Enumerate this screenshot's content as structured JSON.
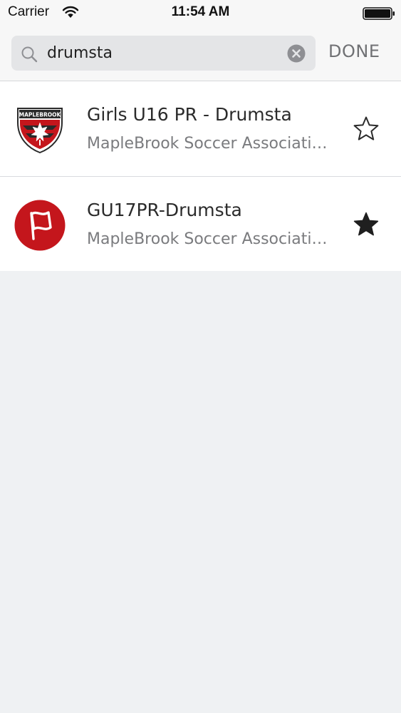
{
  "status_bar": {
    "carrier": "Carrier",
    "time": "11:54 AM"
  },
  "search": {
    "value": "drumsta",
    "done_label": "DONE"
  },
  "results": [
    {
      "title": "Girls U16 PR - Drumsta",
      "subtitle": "MapleBrook Soccer Association",
      "logo": "maplebrook-crest",
      "logo_text": "MAPLEBROOK",
      "favorite": false
    },
    {
      "title": "GU17PR-Drumsta",
      "subtitle": "MapleBrook Soccer Association",
      "logo": "red-flag-circle",
      "favorite": true
    }
  ],
  "colors": {
    "background": "#eff1f3",
    "row": "#ffffff",
    "title": "#2b2b2b",
    "subtitle": "#7a7b7e",
    "done": "#707174",
    "logo_red": "#c4161c"
  }
}
